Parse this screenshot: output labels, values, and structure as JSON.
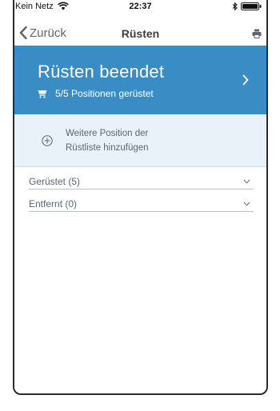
{
  "status_bar": {
    "carrier": "Kein Netz",
    "time": "22:37"
  },
  "nav": {
    "back_label": "Zurück",
    "title": "Rüsten"
  },
  "hero": {
    "title": "Rüsten beendet",
    "subtitle": "5/5 Positionen gerüstet",
    "color": "#3a8cc4"
  },
  "add_position": {
    "label_line1": "Weitere Position der",
    "label_line2": "Rüstliste hinzufügen"
  },
  "sections": [
    {
      "label": "Gerüstet (5)"
    },
    {
      "label": "Entfernt (0)"
    }
  ],
  "colors": {
    "accent": "#3a8cc4",
    "panel": "#e9f2f8",
    "text_muted": "#5a6670"
  }
}
